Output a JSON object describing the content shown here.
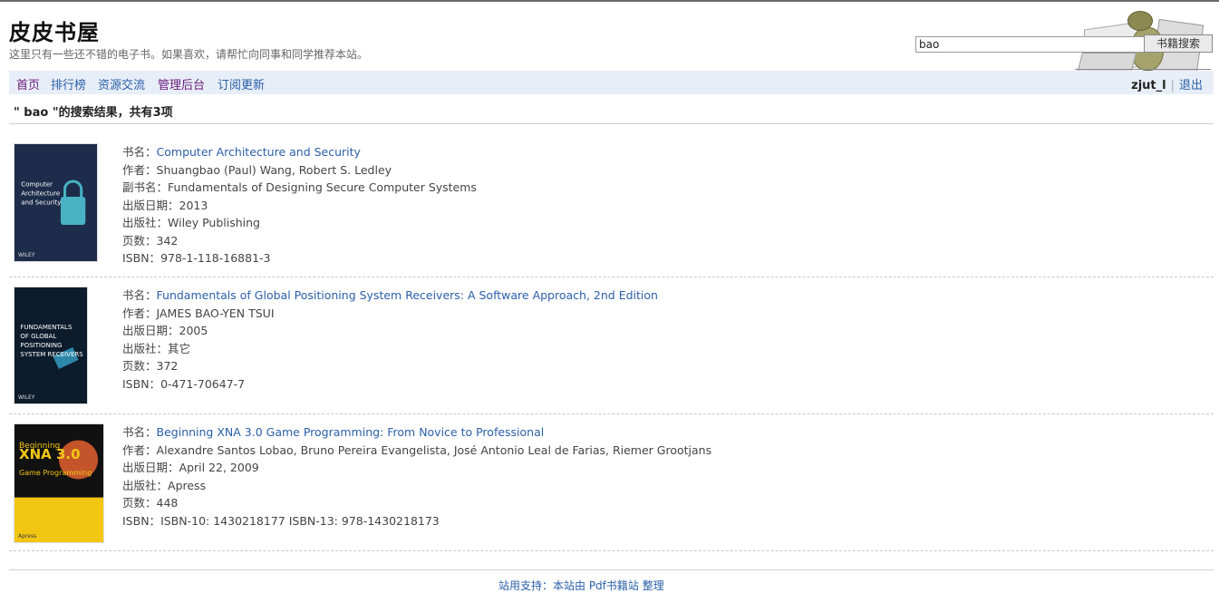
{
  "site": {
    "title": "皮皮书屋",
    "subtitle": "这里只有一些还不错的电子书。如果喜欢，请帮忙向同事和同学推荐本站。"
  },
  "search": {
    "value": "bao",
    "button_label": "书籍搜索"
  },
  "nav": {
    "items": [
      {
        "label": "首页",
        "color": "#6a1b7a"
      },
      {
        "label": "排行榜",
        "color": "#2a5fa8"
      },
      {
        "label": "资源交流",
        "color": "#2a5fa8"
      },
      {
        "label": "管理后台",
        "color": "#6a1b7a"
      },
      {
        "label": "订阅更新",
        "color": "#2a5fa8"
      }
    ],
    "user": "zjut_l",
    "separator": "|",
    "logout": "退出"
  },
  "results": {
    "heading": "\" bao \"的搜索结果，共有3项",
    "books": [
      {
        "cover": {
          "bg": "#1d2c4a",
          "lines": [
            "Computer",
            "Architecture",
            "and Security"
          ],
          "accent": "#49b2c4",
          "icon": "padlock-icon",
          "publisher": "WILEY"
        },
        "fields": [
          {
            "label": "书名：",
            "value": "Computer Architecture and Security",
            "link": true
          },
          {
            "label": "作者：",
            "value": "Shuangbao (Paul) Wang, Robert S. Ledley"
          },
          {
            "label": "副书名：",
            "value": "Fundamentals of Designing Secure Computer Systems"
          },
          {
            "label": "出版日期：",
            "value": "2013"
          },
          {
            "label": "出版社：",
            "value": "Wiley Publishing"
          },
          {
            "label": "页数：",
            "value": "342"
          },
          {
            "label": "ISBN：",
            "value": "978-1-118-16881-3"
          }
        ]
      },
      {
        "cover": {
          "bg": "#0c1c2c",
          "lines": [
            "FUNDAMENTALS",
            "OF GLOBAL",
            "POSITIONING",
            "SYSTEM RECEIVERS"
          ],
          "accent": "#2c87a9",
          "icon": "satellite-icon",
          "publisher": "WILEY"
        },
        "fields": [
          {
            "label": "书名：",
            "value": "Fundamentals of Global Positioning System Receivers: A Software Approach, 2nd Edition",
            "link": true
          },
          {
            "label": "作者：",
            "value": "JAMES BAO-YEN TSUI"
          },
          {
            "label": "出版日期：",
            "value": "2005"
          },
          {
            "label": "出版社：",
            "value": "其它"
          },
          {
            "label": "页数：",
            "value": "372"
          },
          {
            "label": "ISBN：",
            "value": "0-471-70647-7"
          }
        ]
      },
      {
        "cover": {
          "bg": "#111111",
          "lines": [
            "Beginning",
            "XNA 3.0",
            "Game Programming"
          ],
          "accent": "#f2c714",
          "icon": "planet-icon",
          "publisher": "Apress"
        },
        "fields": [
          {
            "label": "书名：",
            "value": "Beginning XNA 3.0 Game Programming: From Novice to Professional",
            "link": true
          },
          {
            "label": "作者：",
            "value": "Alexandre Santos Lobao, Bruno Pereira Evangelista, José Antonio Leal de Farias, Riemer Grootjans"
          },
          {
            "label": "出版日期：",
            "value": "April 22, 2009"
          },
          {
            "label": "出版社：",
            "value": "Apress"
          },
          {
            "label": "页数：",
            "value": "448"
          },
          {
            "label": "ISBN：",
            "value": "ISBN-10: 1430218177 ISBN-13: 978-1430218173"
          }
        ]
      }
    ]
  },
  "footer": {
    "text": "站用支持：本站由 Pdf书籍站 整理"
  }
}
